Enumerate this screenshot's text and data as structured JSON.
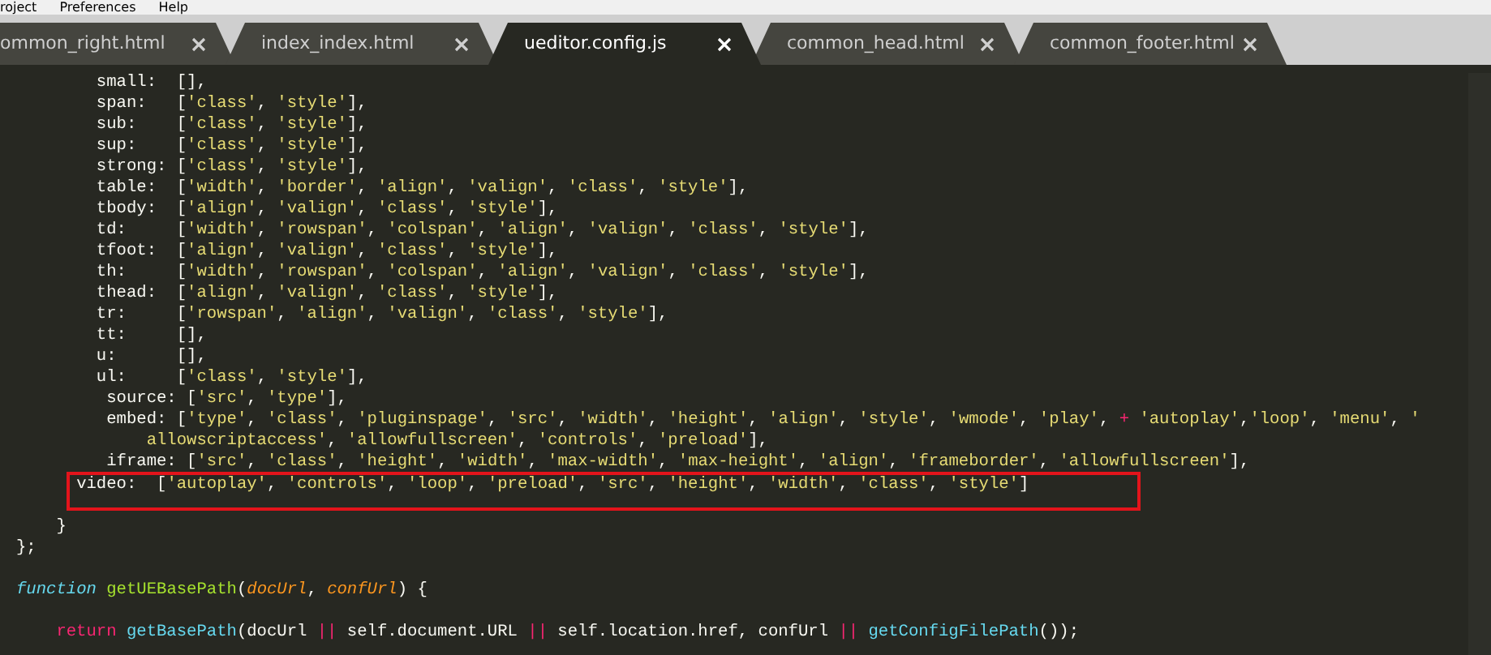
{
  "menu": [
    "roject",
    "Preferences",
    "Help"
  ],
  "tabs": [
    {
      "label": "ommon_right.html",
      "selected": false
    },
    {
      "label": "index_index.html",
      "selected": false
    },
    {
      "label": "ueditor.config.js",
      "selected": true
    },
    {
      "label": "common_head.html",
      "selected": false
    },
    {
      "label": "common_footer.html",
      "selected": false
    }
  ],
  "code_blocks": [
    {
      "lines": [
        {
          "text": "        small:  [],",
          "highlighted": false
        },
        {
          "text": "        span:   ['class', 'style'],",
          "highlighted": false
        },
        {
          "text": "        sub:    ['class', 'style'],",
          "highlighted": false
        },
        {
          "text": "        sup:    ['class', 'style'],",
          "highlighted": false
        },
        {
          "text": "        strong: ['class', 'style'],",
          "highlighted": false
        },
        {
          "text": "        table:  ['width', 'border', 'align', 'valign', 'class', 'style'],",
          "highlighted": false
        },
        {
          "text": "        tbody:  ['align', 'valign', 'class', 'style'],",
          "highlighted": false
        },
        {
          "text": "        td:     ['width', 'rowspan', 'colspan', 'align', 'valign', 'class', 'style'],",
          "highlighted": false
        },
        {
          "text": "        tfoot:  ['align', 'valign', 'class', 'style'],",
          "highlighted": false
        },
        {
          "text": "        th:     ['width', 'rowspan', 'colspan', 'align', 'valign', 'class', 'style'],",
          "highlighted": false
        },
        {
          "text": "        thead:  ['align', 'valign', 'class', 'style'],",
          "highlighted": false
        },
        {
          "text": "        tr:     ['rowspan', 'align', 'valign', 'class', 'style'],",
          "highlighted": false
        },
        {
          "text": "        tt:     [],",
          "highlighted": false
        },
        {
          "text": "        u:      [],",
          "highlighted": false
        },
        {
          "text": "        ul:     ['class', 'style'],",
          "highlighted": false
        },
        {
          "text": "         source: ['src', 'type'],",
          "highlighted": false
        },
        {
          "tokens": [
            {
              "kind": "plain",
              "text": "         embed: "
            },
            {
              "kind": "auto",
              "text": "['type', 'class', 'pluginspage', 'src', 'width', 'height', 'align', 'style', 'wmode', 'play', "
            },
            {
              "kind": "operator",
              "text": "+"
            },
            {
              "kind": "auto",
              "text": " 'autoplay','loop', 'menu', '"
            }
          ],
          "highlighted": false
        },
        {
          "tokens": [
            {
              "kind": "string",
              "text": "             allowscriptaccess'"
            },
            {
              "kind": "auto",
              "text": ", 'allowfullscreen', 'controls', 'preload'],"
            }
          ],
          "highlighted": false
        },
        {
          "text": "         iframe: ['src', 'class', 'height', 'width', 'max-width', 'max-height', 'align', 'frameborder', 'allowfullscreen'],",
          "highlighted": false
        },
        {
          "text": "      video:  ['autoplay', 'controls', 'loop', 'preload', 'src', 'height', 'width', 'class', 'style']",
          "highlighted": true
        }
      ]
    },
    {
      "lines": [
        {
          "text": "    }",
          "highlighted": false
        },
        {
          "text": "};",
          "highlighted": false
        }
      ]
    },
    {
      "lines": [
        {
          "tokens": [
            {
              "kind": "storage",
              "text": "function"
            },
            {
              "kind": "entity",
              "text": " getUEBasePath"
            },
            {
              "kind": "plain",
              "text": "("
            },
            {
              "kind": "param",
              "text": "docUrl"
            },
            {
              "kind": "plain",
              "text": ", "
            },
            {
              "kind": "param",
              "text": "confUrl"
            },
            {
              "kind": "plain",
              "text": ") {"
            }
          ],
          "highlighted": false
        }
      ]
    },
    {
      "lines": [
        {
          "tokens": [
            {
              "kind": "operator",
              "text": "    return"
            },
            {
              "kind": "support",
              "text": " getBasePath"
            },
            {
              "kind": "plain",
              "text": "(docUrl "
            },
            {
              "kind": "operator",
              "text": "||"
            },
            {
              "kind": "plain",
              "text": " self.document.URL "
            },
            {
              "kind": "operator",
              "text": "||"
            },
            {
              "kind": "plain",
              "text": " self.location.href, confUrl "
            },
            {
              "kind": "operator",
              "text": "||"
            },
            {
              "kind": "support",
              "text": " getConfigFilePath"
            },
            {
              "kind": "plain",
              "text": "());"
            }
          ],
          "highlighted": false
        }
      ]
    }
  ]
}
